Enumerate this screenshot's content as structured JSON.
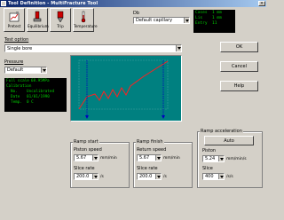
{
  "window": {
    "title": "Tool Definition - MultiFracture Tool",
    "close_glyph": "×"
  },
  "toolbar": [
    {
      "label": "Pretest",
      "icon": "pretest-icon"
    },
    {
      "label": "Equilibrium",
      "icon": "equilibrium-icon"
    },
    {
      "label": "Trip",
      "icon": "trip-icon"
    },
    {
      "label": "Temperature",
      "icon": "temperature-icon"
    }
  ],
  "db": {
    "label": "Db",
    "value": "Default capillary"
  },
  "status": [
    {
      "key": "Cases",
      "value": "1 mm"
    },
    {
      "key": "Lis",
      "value": "1 mm"
    },
    {
      "key": "Entry",
      "value": "11"
    }
  ],
  "test_option": {
    "label": "Test option",
    "value": "Single bore"
  },
  "pressure": {
    "label": "Pressure",
    "value": "Default"
  },
  "gauge_info": [
    {
      "key": "Full scale",
      "value": "68.95MPa",
      "wide": true
    },
    {
      "key": "Calibration",
      "value": "",
      "wide": true
    },
    {
      "key": "No.",
      "value": "Uncalibrated"
    },
    {
      "key": "Date",
      "value": "01/01/1990"
    },
    {
      "key": "Temp.",
      "value": "0 C"
    }
  ],
  "buttons": {
    "ok": "OK",
    "cancel": "Cancel",
    "help": "Help",
    "auto": "Auto"
  },
  "ramp_start": {
    "title": "Ramp start",
    "piston_speed_label": "Piston speed",
    "piston_speed_value": "5.67",
    "piston_speed_unit": "mm/min",
    "slice_rate_label": "Slice rate",
    "slice_rate_value": "200.0",
    "slice_rate_unit": "/s"
  },
  "ramp_finish": {
    "title": "Ramp finish",
    "piston_speed_label": "Return speed",
    "piston_speed_value": "5.67",
    "piston_speed_unit": "mm/min",
    "slice_rate_label": "Slice rate",
    "slice_rate_value": "200.0",
    "slice_rate_unit": "/s"
  },
  "ramp_acceleration": {
    "title": "Ramp acceleration",
    "piston_label": "Piston",
    "piston_value": "5.24",
    "piston_unit": "mm/min/s",
    "slice_label": "Slice",
    "slice_value": "400",
    "slice_unit": "/s/s"
  },
  "colors": {
    "chart_bg": "#008080",
    "trace": "#ff2020",
    "marker": "#0000c0",
    "titlebar": "#0a246a"
  }
}
